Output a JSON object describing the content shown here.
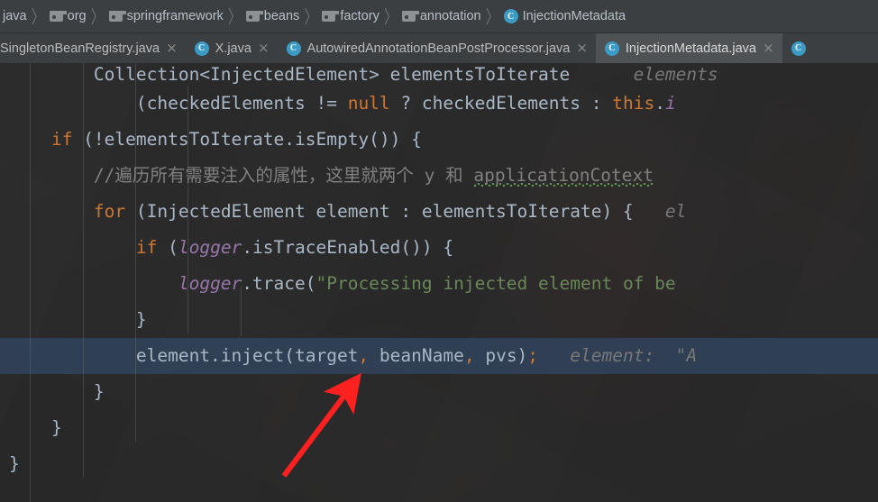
{
  "breadcrumb": {
    "items": [
      {
        "label": "java",
        "icon": "none"
      },
      {
        "label": "org",
        "icon": "folder-icon"
      },
      {
        "label": "springframework",
        "icon": "folder-icon"
      },
      {
        "label": "beans",
        "icon": "folder-icon"
      },
      {
        "label": "factory",
        "icon": "folder-icon"
      },
      {
        "label": "annotation",
        "icon": "folder-icon"
      },
      {
        "label": "InjectionMetadata",
        "icon": "class-icon"
      }
    ],
    "separator": "〉",
    "class_icon_glyph": "C"
  },
  "tabs": {
    "close_glyph": "×",
    "class_icon_glyph": "C",
    "items": [
      {
        "label": "SingletonBeanRegistry.java",
        "active": false,
        "icon": "class-icon"
      },
      {
        "label": "X.java",
        "active": false,
        "icon": "class-icon"
      },
      {
        "label": "AutowiredAnnotationBeanPostProcessor.java",
        "active": false,
        "icon": "class-icon"
      },
      {
        "label": "InjectionMetadata.java",
        "active": true,
        "icon": "class-icon"
      },
      {
        "label": "",
        "active": false,
        "icon": "class-icon"
      }
    ]
  },
  "editor": {
    "file": "InjectionMetadata.java",
    "current_line_highlight": "#324865",
    "lines": [
      {
        "id": "line-collection-decl",
        "segments": [
          {
            "text": "        Collection<InjectedElement> elementsToIterate",
            "style": "pln"
          },
          {
            "text": "      elements",
            "style": "hint"
          }
        ]
      },
      {
        "id": "line-ternary",
        "segments": [
          {
            "text": "            (checkedElements ",
            "style": "pln"
          },
          {
            "text": "!=",
            "style": "pln"
          },
          {
            "text": " ",
            "style": "pln"
          },
          {
            "text": "null",
            "style": "kw"
          },
          {
            "text": " ? checkedElements : ",
            "style": "pln"
          },
          {
            "text": "this",
            "style": "kw"
          },
          {
            "text": ".",
            "style": "pln"
          },
          {
            "text": "i",
            "style": "fld"
          }
        ]
      },
      {
        "id": "line-if-isempty",
        "segments": [
          {
            "text": "    ",
            "style": "pln"
          },
          {
            "text": "if",
            "style": "kw"
          },
          {
            "text": " (!elementsToIterate.isEmpty()) {",
            "style": "pln"
          }
        ]
      },
      {
        "id": "line-chinese-comment",
        "segments": [
          {
            "text": "        //遍历所有需要注入的属性，这里就两个 y 和 ",
            "style": "cmt"
          },
          {
            "text": "applicationCotext",
            "style": "cmt typo"
          }
        ]
      },
      {
        "id": "line-for-loop",
        "segments": [
          {
            "text": "        ",
            "style": "pln"
          },
          {
            "text": "for",
            "style": "kw"
          },
          {
            "text": " (InjectedElement element : elementsToIterate) {",
            "style": "pln"
          },
          {
            "text": "   el",
            "style": "hint"
          }
        ]
      },
      {
        "id": "line-if-trace-enabled",
        "segments": [
          {
            "text": "            ",
            "style": "pln"
          },
          {
            "text": "if",
            "style": "kw"
          },
          {
            "text": " (",
            "style": "pln"
          },
          {
            "text": "logger",
            "style": "fld"
          },
          {
            "text": ".isTraceEnabled()) {",
            "style": "pln"
          }
        ]
      },
      {
        "id": "line-logger-trace",
        "segments": [
          {
            "text": "                ",
            "style": "pln"
          },
          {
            "text": "logger",
            "style": "fld"
          },
          {
            "text": ".trace(",
            "style": "pln"
          },
          {
            "text": "\"Processing injected element of be",
            "style": "str"
          }
        ]
      },
      {
        "id": "line-close-brace-1",
        "segments": [
          {
            "text": "            }",
            "style": "pln"
          }
        ]
      },
      {
        "id": "line-element-inject",
        "current": true,
        "segments": [
          {
            "text": "            element.inject(target",
            "style": "pln"
          },
          {
            "text": ",",
            "style": "kw"
          },
          {
            "text": " beanName",
            "style": "pln"
          },
          {
            "text": ",",
            "style": "kw"
          },
          {
            "text": " pvs)",
            "style": "pln"
          },
          {
            "text": ";",
            "style": "kw"
          },
          {
            "text": "   element:  \"A",
            "style": "hint"
          }
        ]
      },
      {
        "id": "line-close-brace-2",
        "segments": [
          {
            "text": "        }",
            "style": "pln"
          }
        ]
      },
      {
        "id": "line-close-brace-3",
        "segments": [
          {
            "text": "    }",
            "style": "pln"
          }
        ]
      },
      {
        "id": "line-close-brace-4",
        "segments": [
          {
            "text": "}",
            "style": "pln"
          }
        ]
      }
    ]
  },
  "annotation": {
    "arrow_color": "#ff2020",
    "description": "red-arrow-pointing-to-inject-call"
  }
}
